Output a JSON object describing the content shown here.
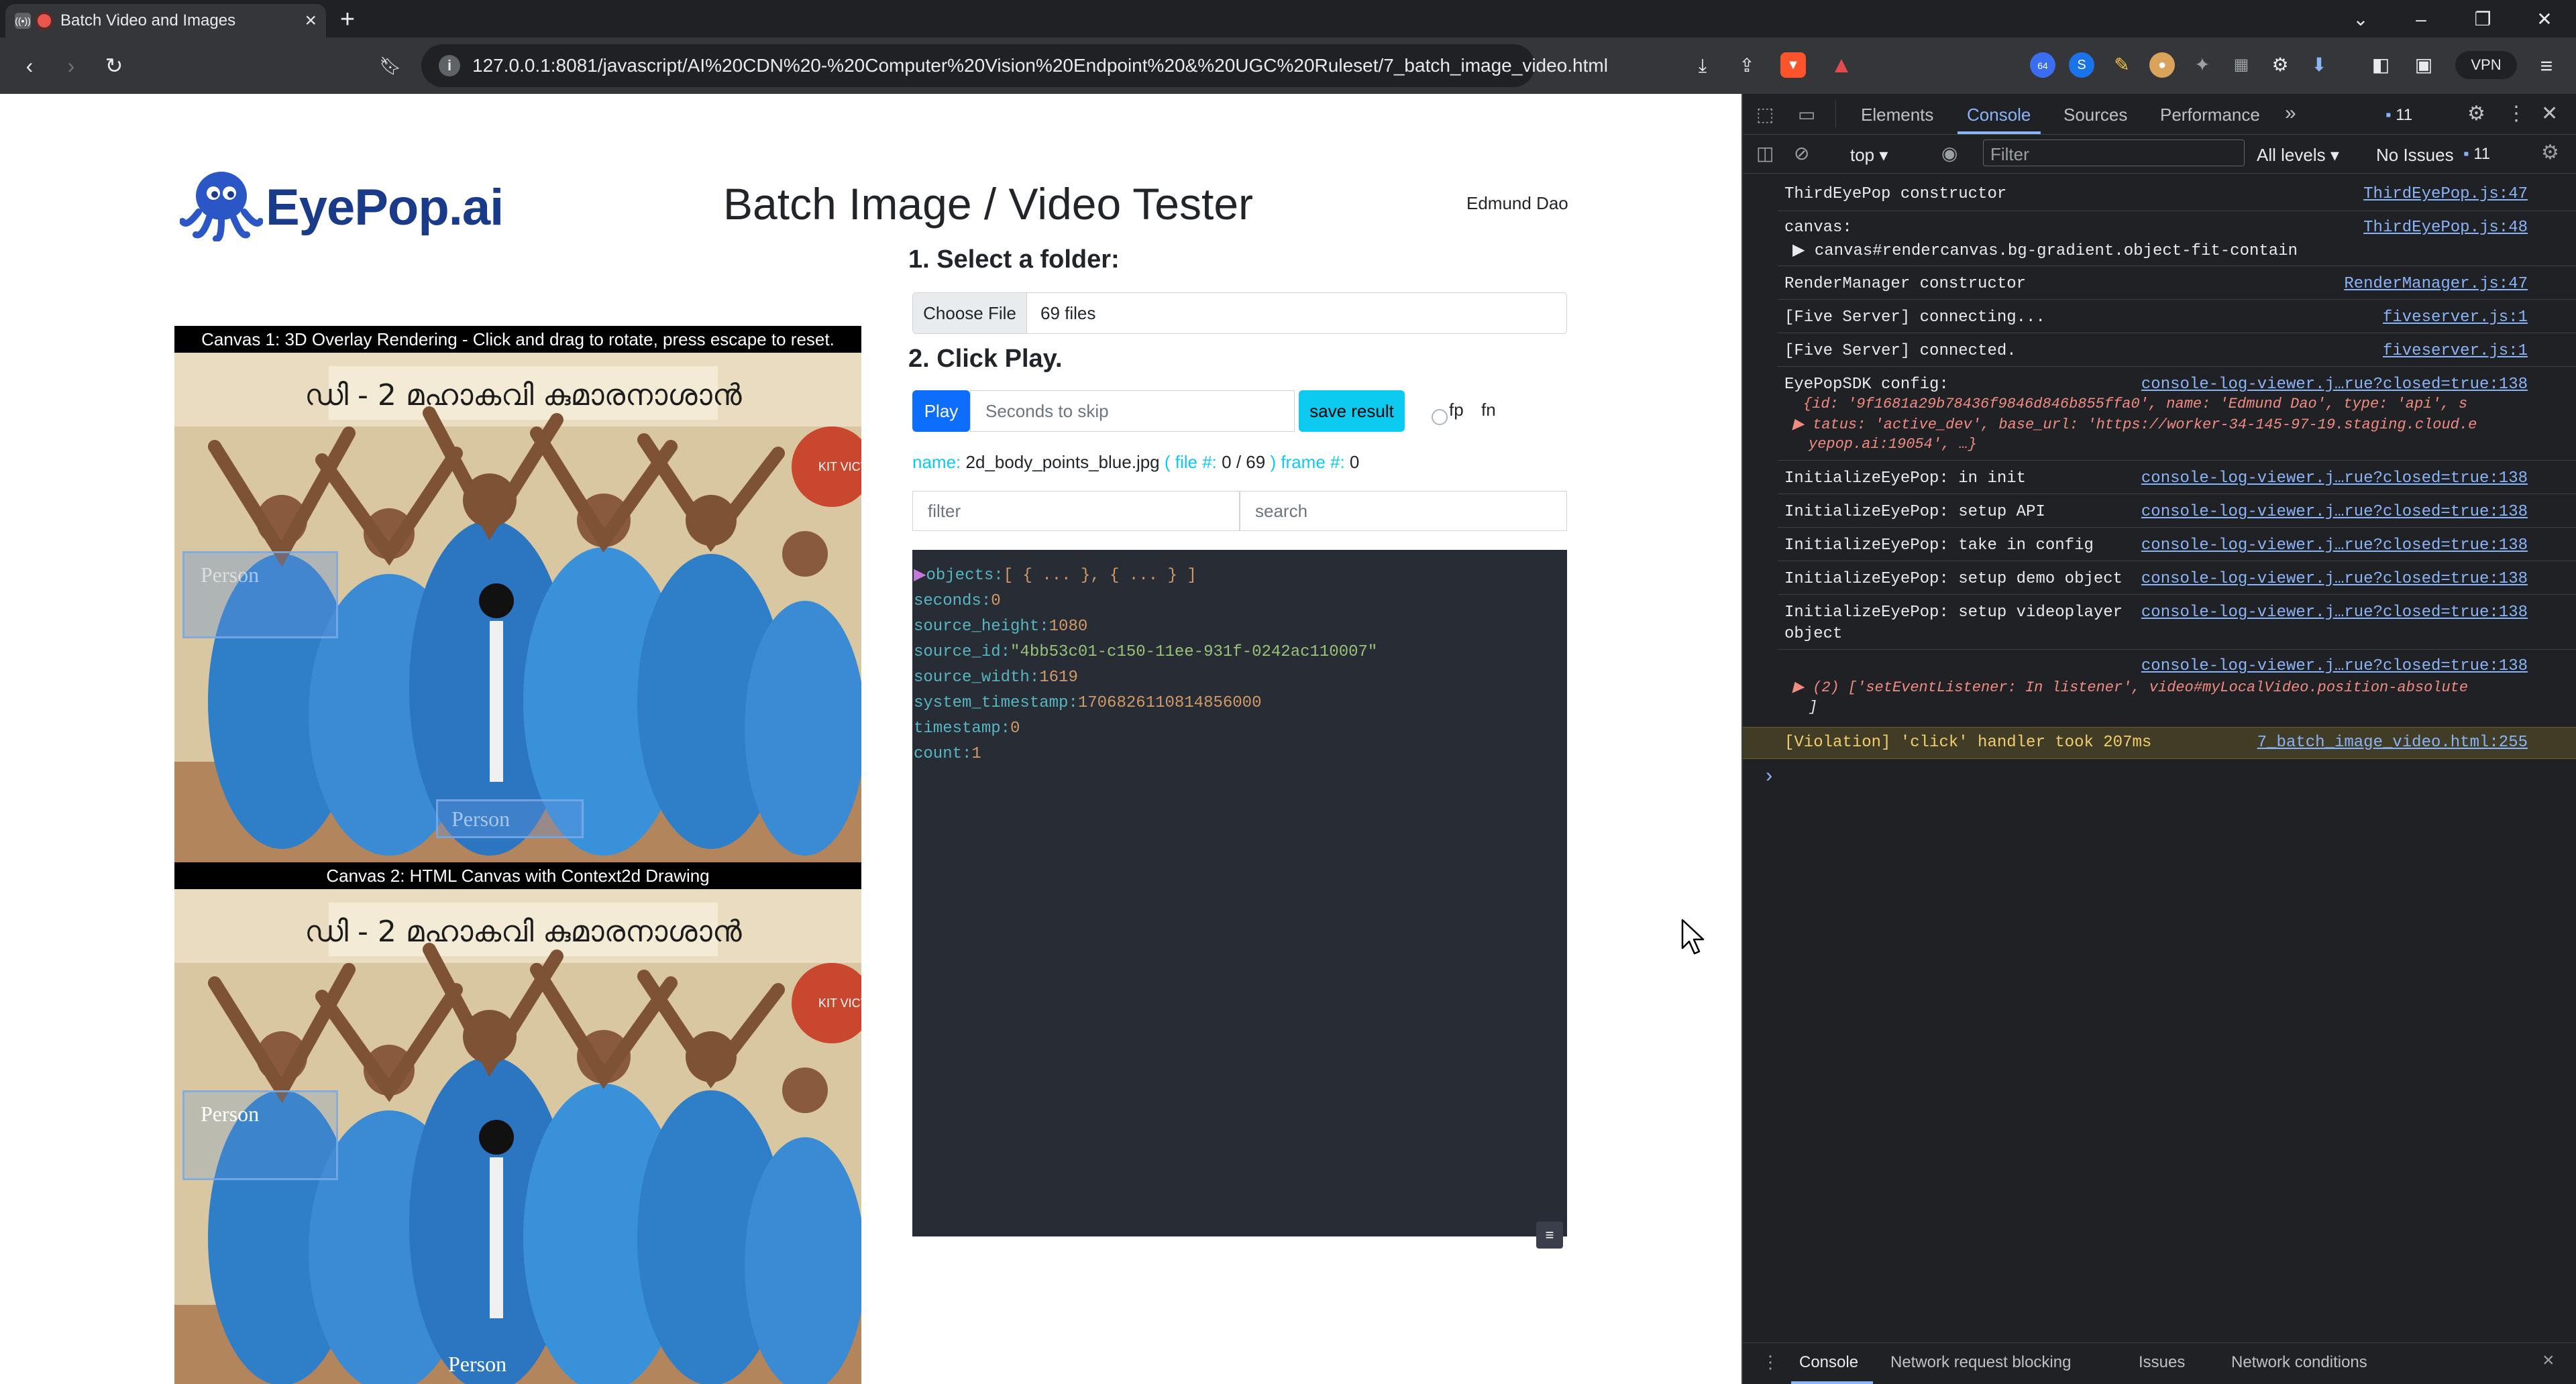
{
  "browser": {
    "tab_title": "Batch Video and Images",
    "tab_close": "×",
    "new_tab": "+",
    "url": "127.0.0.1:8081/javascript/AI%20CDN%20-%20Computer%20Vision%20Endpoint%20&%20UGC%20Ruleset/7_batch_image_video.html",
    "url_host": "127.0.0.1",
    "extension_badge": "64",
    "vpn_label": "VPN"
  },
  "page": {
    "logo_text_1": "EyePop",
    "logo_text_2": ".ai",
    "title": "Batch Image / Video Tester",
    "user": "Edmund Dao",
    "step1": "1. Select a folder:",
    "choose_file": "Choose File",
    "file_count": "69 files",
    "step2": "2. Click Play.",
    "play": "Play",
    "skip_placeholder": "Seconds to skip",
    "save_result": "save result",
    "radio_fp": "fp",
    "radio_fn": "fn",
    "status": {
      "name_label": "name:",
      "name_value": "2d_body_points_blue.jpg",
      "file_label": "( file #:",
      "file_value": "0 / 69",
      "frame_label": ") frame #:",
      "frame_value": "0"
    },
    "filter_placeholder": "filter",
    "search_placeholder": "search",
    "json": {
      "objects_key": "objects",
      "objects_value": "[ { ... }, { ... } ]",
      "seconds_key": "seconds",
      "seconds_value": "0",
      "source_height_key": "source_height",
      "source_height_value": "1080",
      "source_id_key": "source_id",
      "source_id_value": "\"4bb53c01-c150-11ee-931f-0242ac110007\"",
      "source_width_key": "source_width",
      "source_width_value": "1619",
      "system_timestamp_key": "system_timestamp",
      "system_timestamp_value": "1706826110814856000",
      "timestamp_key": "timestamp",
      "timestamp_value": "0",
      "count_key": "count",
      "count_value": "1"
    },
    "canvas1_header": "Canvas 1: 3D Overlay Rendering - Click and drag to rotate, press escape to reset.",
    "canvas2_header": "Canvas 2: HTML Canvas with Context2d Drawing",
    "person_label": "Person",
    "banner_text": "ഡി - 2 മഹാകവി കുമാരനാശാൻ",
    "kit_text": "KIT VICTER"
  },
  "devtools": {
    "tabs": [
      "Elements",
      "Console",
      "Sources",
      "Performance"
    ],
    "issues_badge": "11",
    "context": "top",
    "filter_placeholder": "Filter",
    "levels": "All levels",
    "no_issues": "No Issues",
    "no_issues_count": "11",
    "logs": [
      {
        "text": "ThirdEyePop constructor",
        "src": "ThirdEyePop.js:47"
      },
      {
        "text": "canvas:",
        "src": "ThirdEyePop.js:48"
      },
      {
        "text": "▶ canvas#rendercanvas.bg-gradient.object-fit-contain",
        "src": ""
      },
      {
        "text": "RenderManager constructor",
        "src": "RenderManager.js:47"
      },
      {
        "text": "[Five Server] connecting...",
        "src": "fiveserver.js:1"
      },
      {
        "text": "[Five Server] connected.",
        "src": "fiveserver.js:1"
      },
      {
        "text": "EyePopSDK config:",
        "src": "console-log-viewer.j…rue?closed=true:138"
      },
      {
        "text": "InitializeEyePop: in init",
        "src": "console-log-viewer.j…rue?closed=true:138"
      },
      {
        "text": "InitializeEyePop: setup API",
        "src": "console-log-viewer.j…rue?closed=true:138"
      },
      {
        "text": "InitializeEyePop: take in config",
        "src": "console-log-viewer.j…rue?closed=true:138"
      },
      {
        "text": "InitializeEyePop: setup demo object",
        "src": "console-log-viewer.j…rue?closed=true:138"
      },
      {
        "text": "InitializeEyePop: setup videoplayer",
        "src": "console-log-viewer.j…rue?closed=true:138"
      },
      {
        "text": "object",
        "src": ""
      },
      {
        "text": "",
        "src": "console-log-viewer.j…rue?closed=true:138"
      },
      {
        "text": "[Violation] 'click' handler took 207ms",
        "src": "7_batch_image_video.html:255"
      }
    ],
    "config_line1": "{id: '9f1681a29b78436f9846d846b855ffa0', name: 'Edmund Dao', type: 'api', s",
    "config_line2": "▶ tatus: 'active_dev', base_url: 'https://worker-34-145-97-19.staging.cloud.e",
    "config_line3": "yepop.ai:19054', …}",
    "listener_line1": "▶ (2) ['setEventListener: In listener', video#myLocalVideo.position-absolute",
    "listener_line2": "]",
    "prompt": "›",
    "drawer_tabs": [
      "Console",
      "Network request blocking",
      "Issues",
      "Network conditions"
    ],
    "drawer_close": "×"
  }
}
